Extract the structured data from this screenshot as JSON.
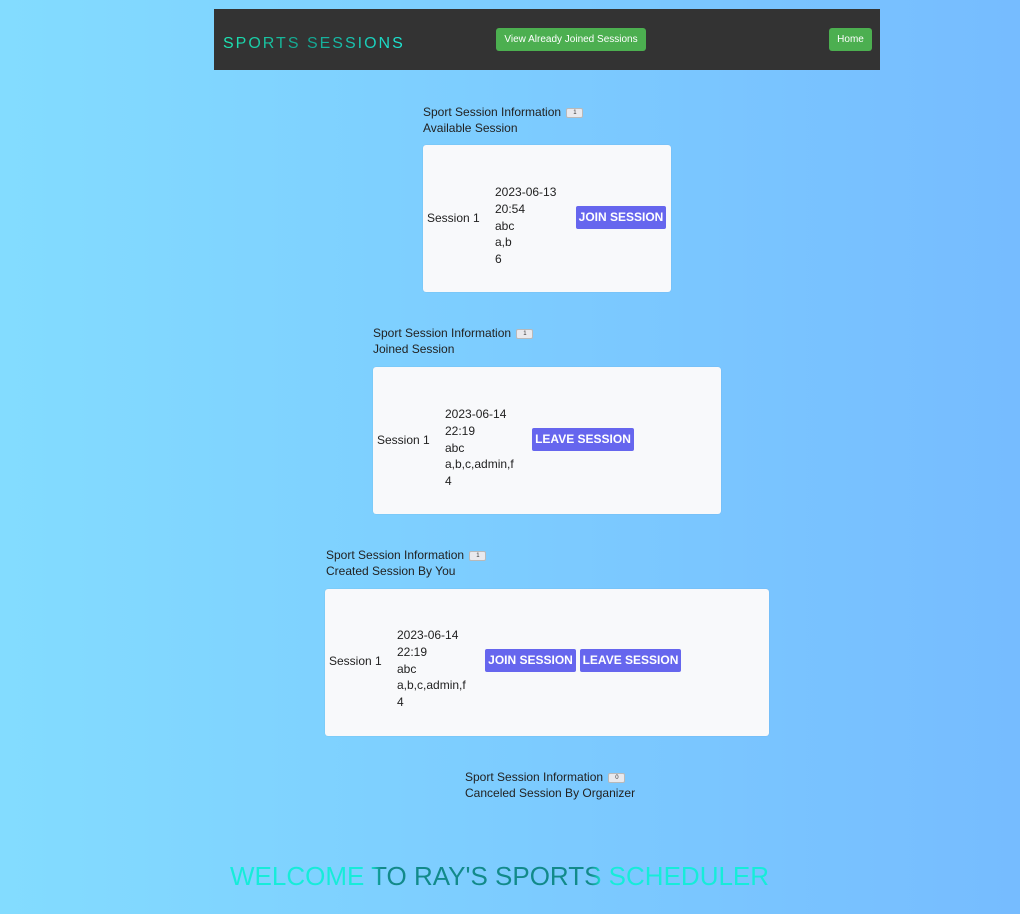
{
  "nav": {
    "brand": "SPORTS SESSIONS",
    "joined_button": "View Already Joined Sessions",
    "home_button": "Home"
  },
  "sections": [
    {
      "title": "Sport Session Information",
      "toggle": "1",
      "subtitle": "Available Session",
      "session": {
        "name": "Session 1",
        "datetime": "2023-06-13 20:54",
        "date": "2023-06-13",
        "time": "20:54",
        "location": "abc",
        "players": "a,b",
        "max": "6"
      },
      "buttons": [
        "JOIN SESSION"
      ]
    },
    {
      "title": "Sport Session Information",
      "toggle": "1",
      "subtitle": "Joined Session",
      "session": {
        "name": "Session 1",
        "date": "2023-06-14",
        "time": "22:19",
        "location": "abc",
        "players": "a,b,c,admin,f",
        "max": "4"
      },
      "buttons": [
        "LEAVE SESSION"
      ]
    },
    {
      "title": "Sport Session Information",
      "toggle": "1",
      "subtitle": "Created Session By You",
      "session": {
        "name": "Session 1",
        "date": "2023-06-14",
        "time": "22:19",
        "location": "abc",
        "players": "a,b,c,admin,f",
        "max": "4"
      },
      "buttons": [
        "JOIN SESSION",
        "LEAVE SESSION"
      ]
    },
    {
      "title": "Sport Session Information",
      "toggle": "0",
      "subtitle": "Canceled Session By Organizer"
    }
  ],
  "footer": {
    "welcome": "WELCOME TO RAY'S SPORTS SCHEDULER"
  },
  "colors": {
    "navbar": "#333333",
    "nav_button": "#4caf50",
    "action_button": "#6666ee",
    "card": "#f8f9fb",
    "brand_teal": "#1de9b6"
  }
}
